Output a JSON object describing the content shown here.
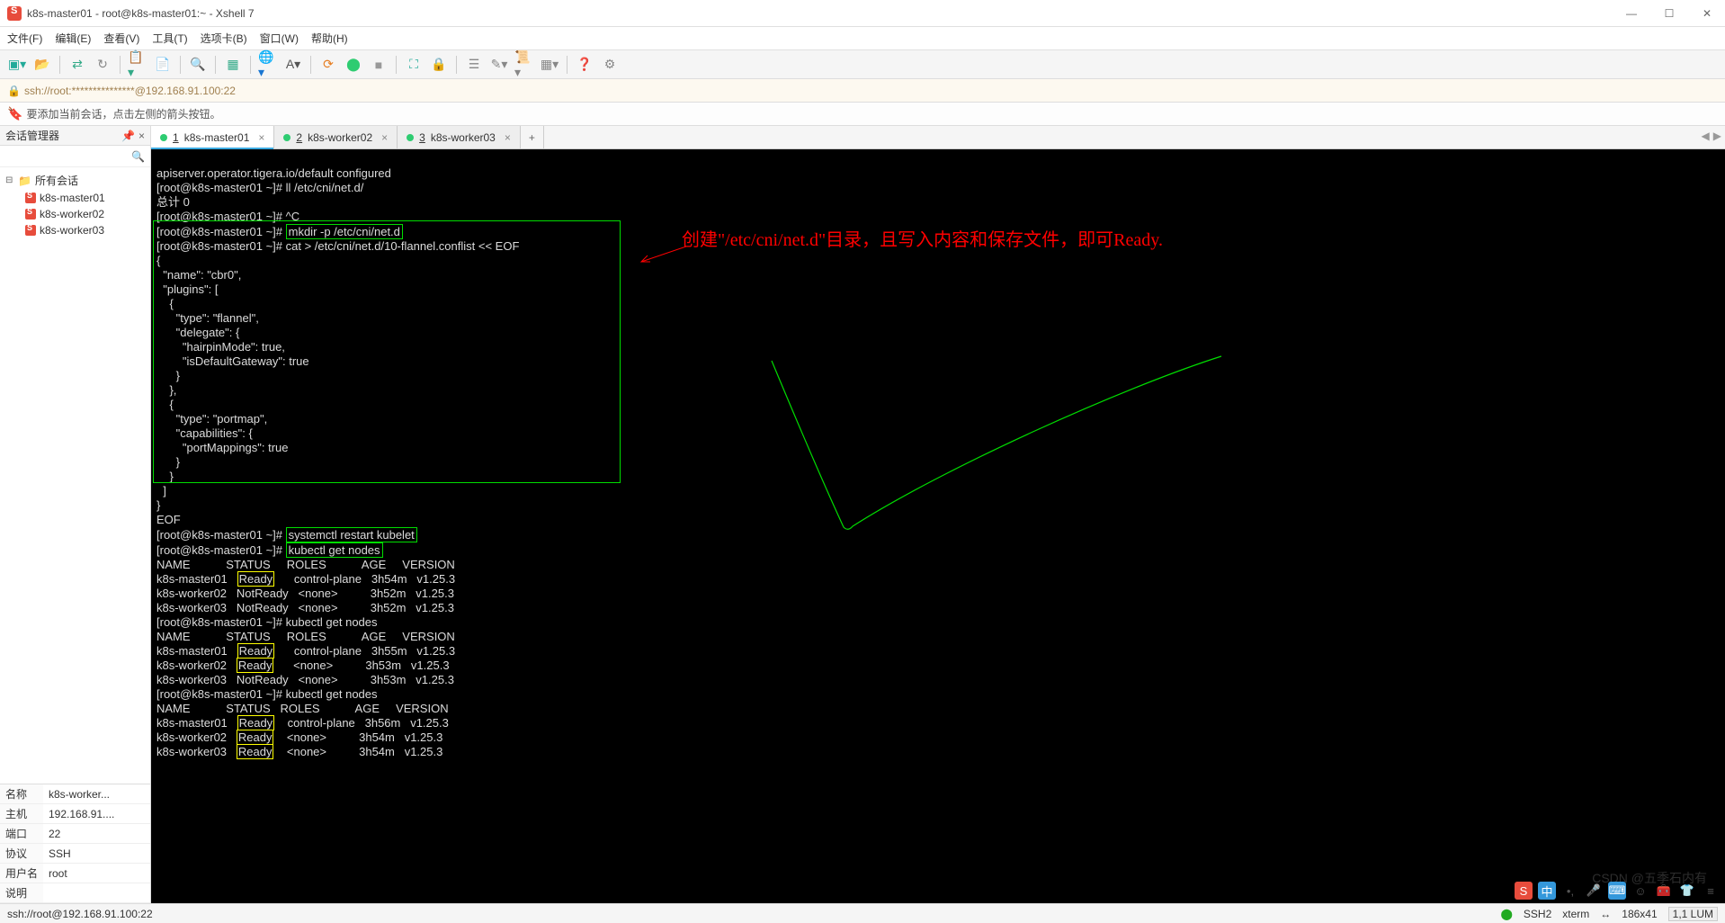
{
  "window": {
    "title": "k8s-master01 - root@k8s-master01:~ - Xshell 7"
  },
  "menu": {
    "file": "文件(F)",
    "edit": "编辑(E)",
    "view": "查看(V)",
    "tools": "工具(T)",
    "tabs": "选项卡(B)",
    "window": "窗口(W)",
    "help": "帮助(H)"
  },
  "address": {
    "url": "ssh://root:***************@192.168.91.100:22"
  },
  "hint": {
    "text": "要添加当前会话，点击左侧的箭头按钮。"
  },
  "sidebar": {
    "title": "会话管理器",
    "root": "所有会话",
    "items": [
      "k8s-master01",
      "k8s-worker02",
      "k8s-worker03"
    ]
  },
  "props": {
    "name_label": "名称",
    "name_val": "k8s-worker...",
    "host_label": "主机",
    "host_val": "192.168.91....",
    "port_label": "端口",
    "port_val": "22",
    "proto_label": "协议",
    "proto_val": "SSH",
    "user_label": "用户名",
    "user_val": "root",
    "desc_label": "说明",
    "desc_val": ""
  },
  "tabs": [
    {
      "num": "1",
      "label": "k8s-master01",
      "active": true
    },
    {
      "num": "2",
      "label": "k8s-worker02",
      "active": false
    },
    {
      "num": "3",
      "label": "k8s-worker03",
      "active": false
    }
  ],
  "terminal": {
    "l01": "apiserver.operator.tigera.io/default configured",
    "l02": "[root@k8s-master01 ~]# ll /etc/cni/net.d/",
    "l03": "总计 0",
    "l04": "[root@k8s-master01 ~]# ^C",
    "l05a": "[root@k8s-master01 ~]# ",
    "l05b": "mkdir -p /etc/cni/net.d",
    "l06": "[root@k8s-master01 ~]# cat > /etc/cni/net.d/10-flannel.conflist << EOF",
    "l07": "{",
    "l08": "  \"name\": \"cbr0\",",
    "l09": "  \"plugins\": [",
    "l10": "    {",
    "l11": "      \"type\": \"flannel\",",
    "l12": "      \"delegate\": {",
    "l13": "        \"hairpinMode\": true,",
    "l14": "        \"isDefaultGateway\": true",
    "l15": "      }",
    "l16": "    },",
    "l17": "    {",
    "l18": "      \"type\": \"portmap\",",
    "l19": "      \"capabilities\": {",
    "l20": "        \"portMappings\": true",
    "l21": "      }",
    "l22": "    }",
    "l23": "  ]",
    "l24": "}",
    "l25": "EOF",
    "l26a": "[root@k8s-master01 ~]# ",
    "l26b": "systemctl restart kubelet",
    "l27a": "[root@k8s-master01 ~]# ",
    "l27b": "kubectl get nodes",
    "h1": "NAME           STATUS     ROLES           AGE     VERSION",
    "r1a": "k8s-master01   ",
    "r1b": "Ready",
    "r1c": "      control-plane   3h54m   v1.25.3",
    "r2": "k8s-worker02   NotReady   <none>          3h52m   v1.25.3",
    "r3": "k8s-worker03   NotReady   <none>          3h52m   v1.25.3",
    "l28": "[root@k8s-master01 ~]# kubectl get nodes",
    "h2": "NAME           STATUS     ROLES           AGE     VERSION",
    "r4a": "k8s-master01   ",
    "r4b": "Ready",
    "r4c": "      control-plane   3h55m   v1.25.3",
    "r5a": "k8s-worker02   ",
    "r5b": "Ready",
    "r5c": "      <none>          3h53m   v1.25.3",
    "r6": "k8s-worker03   NotReady   <none>          3h53m   v1.25.3",
    "l29": "[root@k8s-master01 ~]# kubectl get nodes",
    "h3": "NAME           STATUS   ROLES           AGE     VERSION",
    "r7a": "k8s-master01   ",
    "r7b": "Ready",
    "r7c": "    control-plane   3h56m   v1.25.3",
    "r8a": "k8s-worker02   ",
    "r8b": "Ready",
    "r8c": "    <none>          3h54m   v1.25.3",
    "r9a": "k8s-worker03   ",
    "r9b": "Ready",
    "r9c": "    <none>          3h54m   v1.25.3"
  },
  "annotation": {
    "text": "创建\"/etc/cni/net.d\"目录，且写入内容和保存文件，即可Ready."
  },
  "status": {
    "left": "ssh://root@192.168.91.100:22",
    "ssh": "SSH2",
    "term": "xterm",
    "size": "186x41",
    "enc": "1,1  LUM"
  },
  "watermark": "CSDN @五季石内有"
}
